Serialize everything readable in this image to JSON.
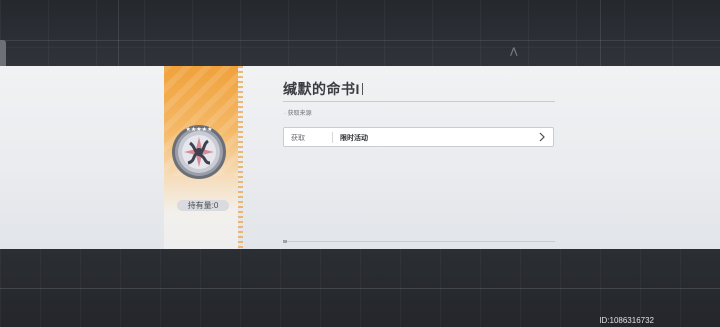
{
  "item": {
    "name": "缄默的命书I",
    "count_label": "持有量:0",
    "stars": "★★★★★",
    "icon": "compass-seal-icon",
    "rarity_color": "#f0a13b"
  },
  "source": {
    "section_label": "· 获取来源",
    "row_label": "获取",
    "row_value": "限时活动",
    "chevron": "chevron-right-icon"
  },
  "footer": {
    "id_text": "ID:1086316732"
  }
}
